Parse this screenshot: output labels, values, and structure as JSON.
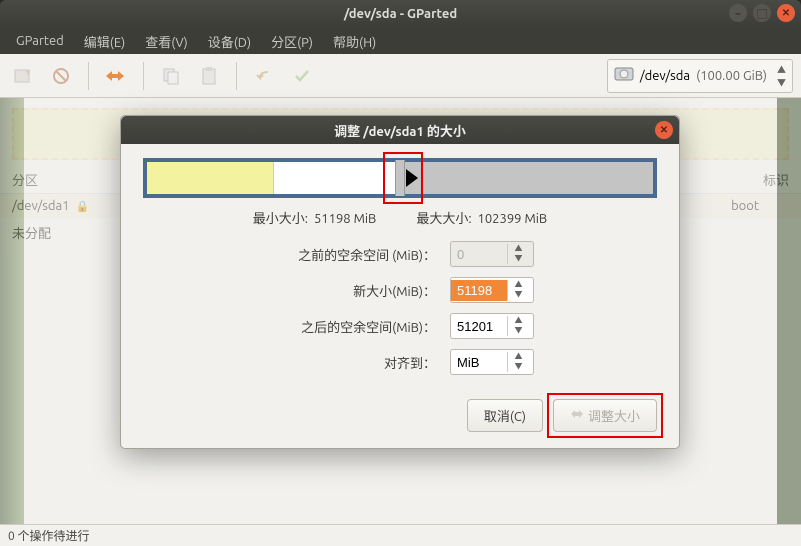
{
  "window": {
    "title": "/dev/sda - GParted"
  },
  "menu": {
    "gparted": "GParted",
    "edit": "编辑(E)",
    "view": "查看(V)",
    "device": "设备(D)",
    "partition": "分区(P)",
    "help": "帮助(H)"
  },
  "device_selector": {
    "device": "/dev/sda",
    "size": "(100.00 GiB)"
  },
  "table": {
    "col_partition": "分区",
    "col_flag": "标识",
    "rows": [
      {
        "part": "/dev/sda1",
        "flag": "boot",
        "locked": true
      },
      {
        "part": "未分配",
        "flag": "",
        "locked": false
      }
    ]
  },
  "statusbar": "0 个操作待进行",
  "dialog": {
    "title": "调整 /dev/sda1 的大小",
    "min_label": "最小大小:",
    "min_value": "51198 MiB",
    "max_label": "最大大小:",
    "max_value": "102399 MiB",
    "before_label": "之前的空余空间 (MiB)：",
    "before_value": "0",
    "newsize_label": "新大小(MiB)：",
    "newsize_value": "51198",
    "after_label": "之后的空余空间(MiB)：",
    "after_value": "51201",
    "align_label": "对齐到：",
    "align_value": "MiB",
    "cancel": "取消(C)",
    "resize": "调整大小"
  }
}
